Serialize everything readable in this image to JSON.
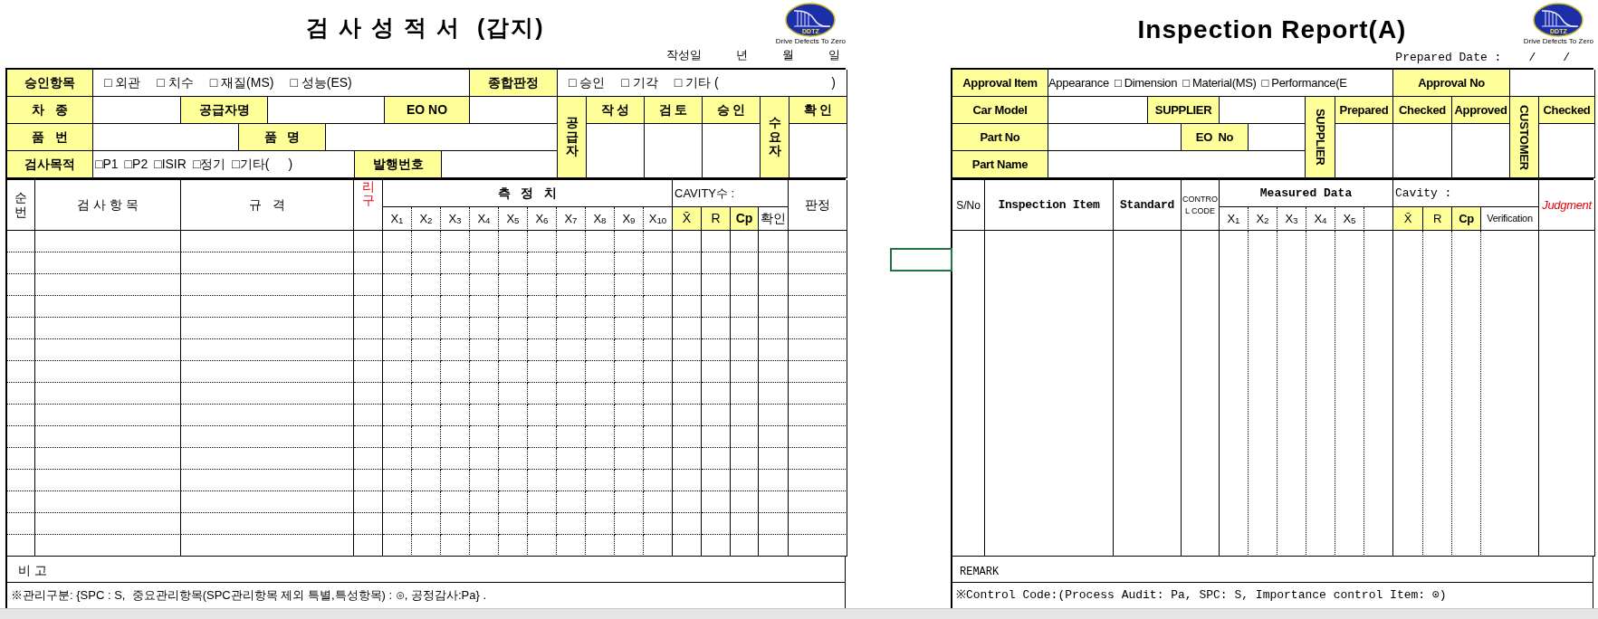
{
  "left_sheet": {
    "title": "검 사 성 적 서  (갑지)",
    "logo": {
      "mark": "DDTZ",
      "tagline": "Drive Defects To Zero"
    },
    "date_line": [
      "작성일",
      "년",
      "월",
      "일"
    ],
    "approval_item_label": "승인항목",
    "approval_items": [
      "□ 외관",
      "□ 치수",
      "□ 재질(MS)",
      "□ 성능(ES)"
    ],
    "overall_judgment_label": "종합판정",
    "overall_judgment_options": [
      "□ 승인",
      "□ 기각",
      "□ 기타 (",
      ")"
    ],
    "car_type_label": "차   종",
    "supplier_name_label": "공급자명",
    "eo_no_label": "EO NO",
    "supplier_label": "공급자",
    "sign_labels": [
      "작 성",
      "검 토",
      "승 인"
    ],
    "customer_label": "수요자",
    "confirm_label": "확 인",
    "part_no_label": "품   번",
    "part_name_label": "품   명",
    "purpose_label": "검사목적",
    "purpose_options": [
      "□P1",
      "□P2",
      "□ISIR",
      "□정기",
      "□기타(",
      ")"
    ],
    "issue_no_label": "발행번호",
    "columns": {
      "serial": "순번",
      "item": "검 사 항 목",
      "spec": "규   격",
      "control": "리구",
      "measured": "측   정   치",
      "cavity": "CAVITY수 :",
      "judgment": "판정",
      "x": [
        "X$_{1}$",
        "X$_{2}$",
        "X$_{3}$",
        "X$_{4}$",
        "X$_{5}$",
        "X$_{6}$",
        "X$_{7}$",
        "X$_{8}$",
        "X$_{9}$",
        "X$_{10}$"
      ],
      "stats": [
        "X̄",
        "R",
        "Cp",
        "확인"
      ]
    },
    "remark_label": "비 고",
    "note": "※관리구분: {SPC : S,  중요관리항목(SPC관리항목 제외 특별,특성항목) : ⊙, 공정감사:Pa} ."
  },
  "right_sheet": {
    "title": "Inspection Report(A)",
    "logo": {
      "mark": "DDTZ",
      "tagline": "Drive Defects To Zero"
    },
    "date_line": [
      "Prepared Date :",
      "/",
      "/"
    ],
    "approval_item_label": "Approval Item",
    "approval_items": [
      "Appearance",
      "□ Dimension",
      "□ Material(MS)",
      "□ Performance(E"
    ],
    "approval_no_label": "Approval No",
    "car_model_label": "Car Model",
    "supplier_label": "SUPPLIER",
    "supplier_vertical_label": "SUPPLIER",
    "sign_labels": [
      "Prepared",
      "Checked",
      "Approved"
    ],
    "customer_label": "CUSTOMER",
    "confirm_label": "Checked",
    "part_no_label": "Part No",
    "eo_no_label": "EO  No",
    "part_name_label": "Part Name",
    "columns": {
      "serial": "S/No",
      "item": "Inspection Item",
      "spec": "Standard",
      "control": "CONTROL CODE",
      "measured": "Measured Data",
      "cavity": "Cavity :",
      "judgment": "Judgment",
      "x": [
        "X$_{1}$",
        "X$_{2}$",
        "X$_{3}$",
        "X$_{4}$",
        "X$_{5}$"
      ],
      "stats": [
        "X̄",
        "R",
        "Cp",
        "Verification"
      ]
    },
    "remark_label": "REMARK",
    "note": "※Control Code:(Process Audit: Pa, SPC: S, Importance control Item: ⊙)"
  }
}
